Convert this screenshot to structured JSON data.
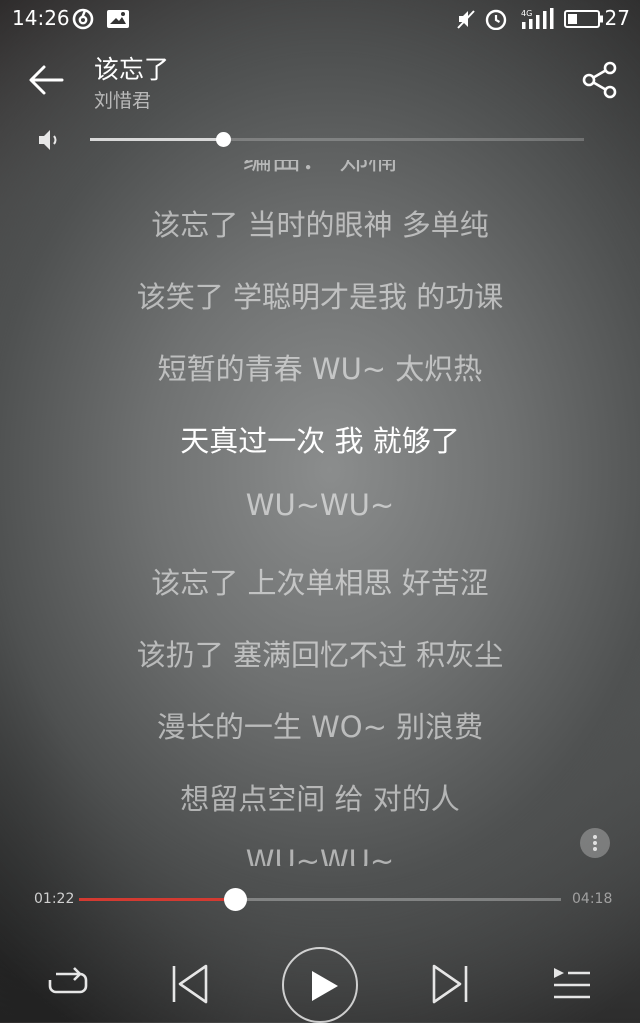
{
  "status_bar": {
    "time": "14:26",
    "battery": "27"
  },
  "header": {
    "title": "该忘了",
    "artist": "刘惜君"
  },
  "volume": {
    "level": 0.27
  },
  "lyrics": {
    "lines": [
      "编曲： 郑楠",
      "该忘了 当时的眼神 多单纯",
      "该笑了 学聪明才是我 的功课",
      "短暂的青春 WU~ 太炽热",
      "天真过一次 我 就够了",
      "WU~WU~",
      "该忘了 上次单相思 好苦涩",
      "该扔了 塞满回忆不过 积灰尘",
      "漫长的一生 WO~ 别浪费",
      "想留点空间 给 对的人",
      "WU~WU~"
    ],
    "current_index": 4
  },
  "progress": {
    "elapsed": "01:22",
    "total": "04:18",
    "fraction": 0.324,
    "accent_color": "#d33a31"
  },
  "controls": {
    "repeat_icon": "repeat-icon",
    "prev_icon": "skip-previous-icon",
    "play_icon": "play-icon",
    "next_icon": "skip-next-icon",
    "playlist_icon": "playlist-icon"
  }
}
